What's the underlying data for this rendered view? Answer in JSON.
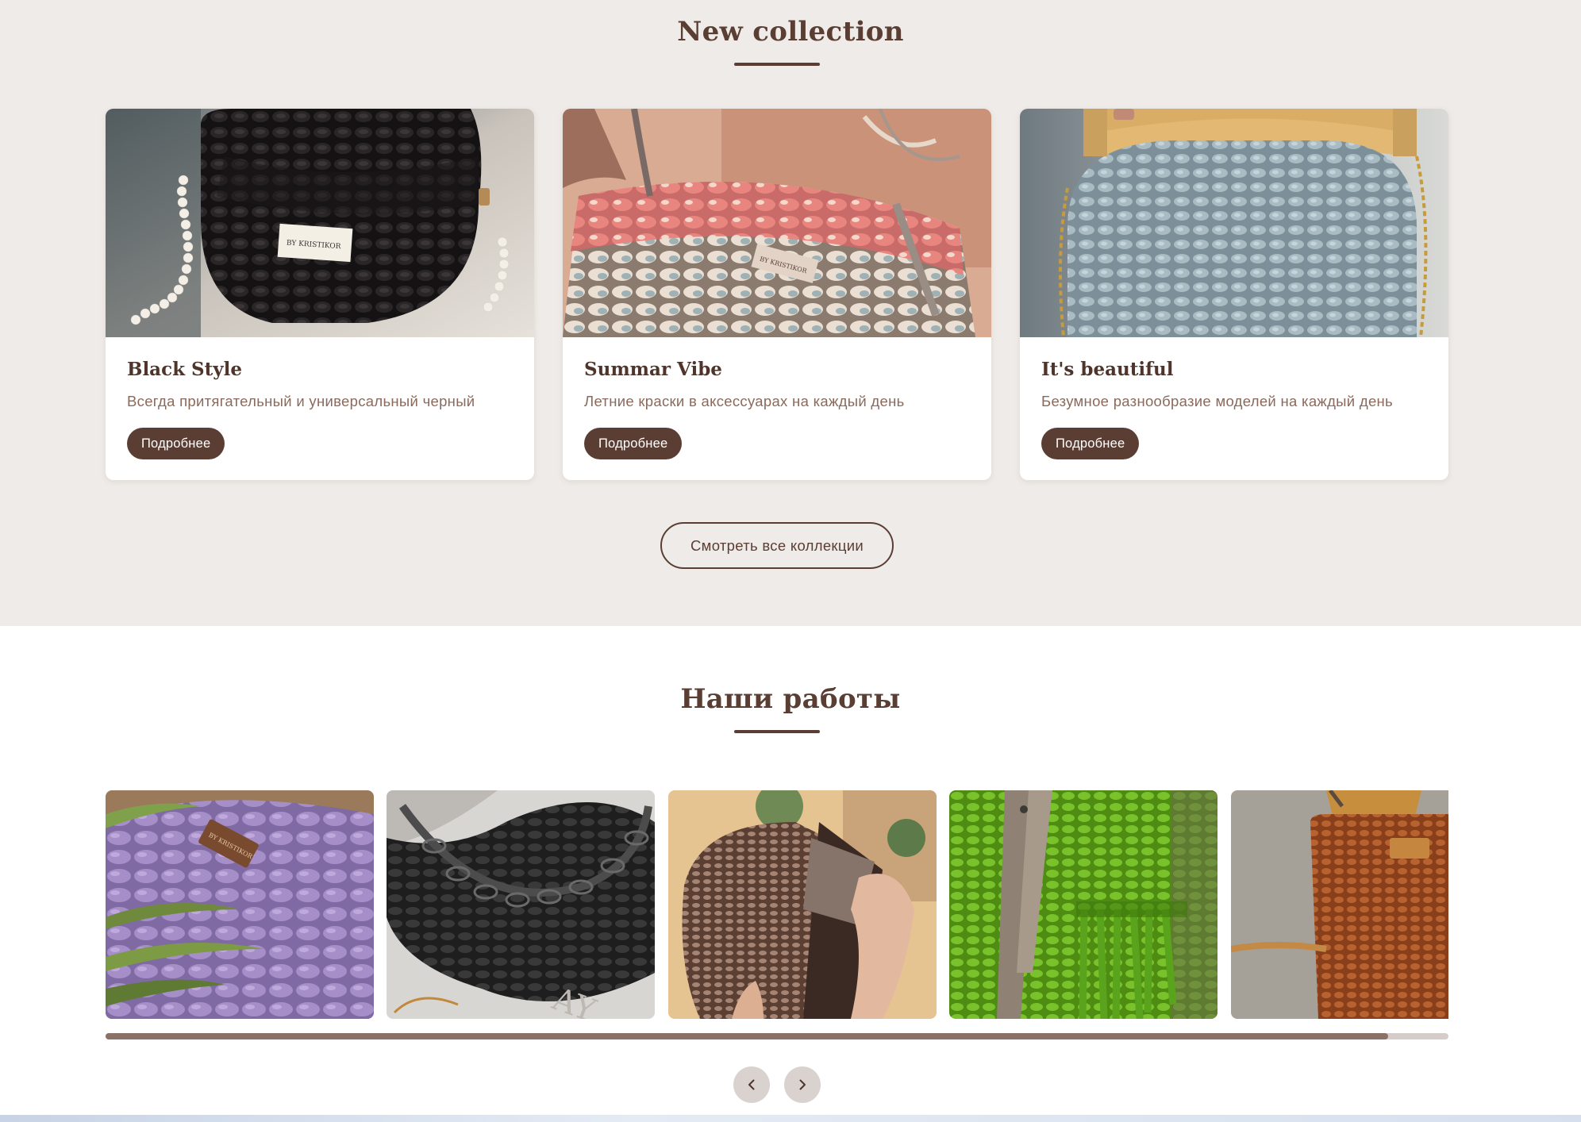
{
  "collection": {
    "title": "New collection",
    "cards": [
      {
        "title": "Black Style",
        "description": "Всегда притягательный и универсальный черный",
        "button": "Подробнее",
        "image": "black-crochet-bag-photo"
      },
      {
        "title": "Summar Vibe",
        "description": "Летние краски в аксессуарах на каждый день",
        "button": "Подробнее",
        "image": "pink-crochet-bag-photo"
      },
      {
        "title": "It's beautiful",
        "description": "Безумное разнообразие моделей на каждый день",
        "button": "Подробнее",
        "image": "blue-crochet-clutch-photo"
      }
    ],
    "all_button": "Смотреть все коллекции"
  },
  "works": {
    "title": "Наши работы",
    "gallery": [
      {
        "image": "purple-crochet-bag-photo"
      },
      {
        "image": "black-crochet-chain-bag-photo"
      },
      {
        "image": "brown-crochet-bag-photo"
      },
      {
        "image": "green-crochet-bag-photo"
      },
      {
        "image": "terracotta-crochet-bag-photo"
      }
    ],
    "scroll_progress": 0.955,
    "prev_icon": "chevron-left-icon",
    "next_icon": "chevron-right-icon"
  },
  "colors": {
    "brand_brown": "#5a3e33",
    "section_bg": "#efebe8",
    "muted_text": "#8a6a5c"
  }
}
